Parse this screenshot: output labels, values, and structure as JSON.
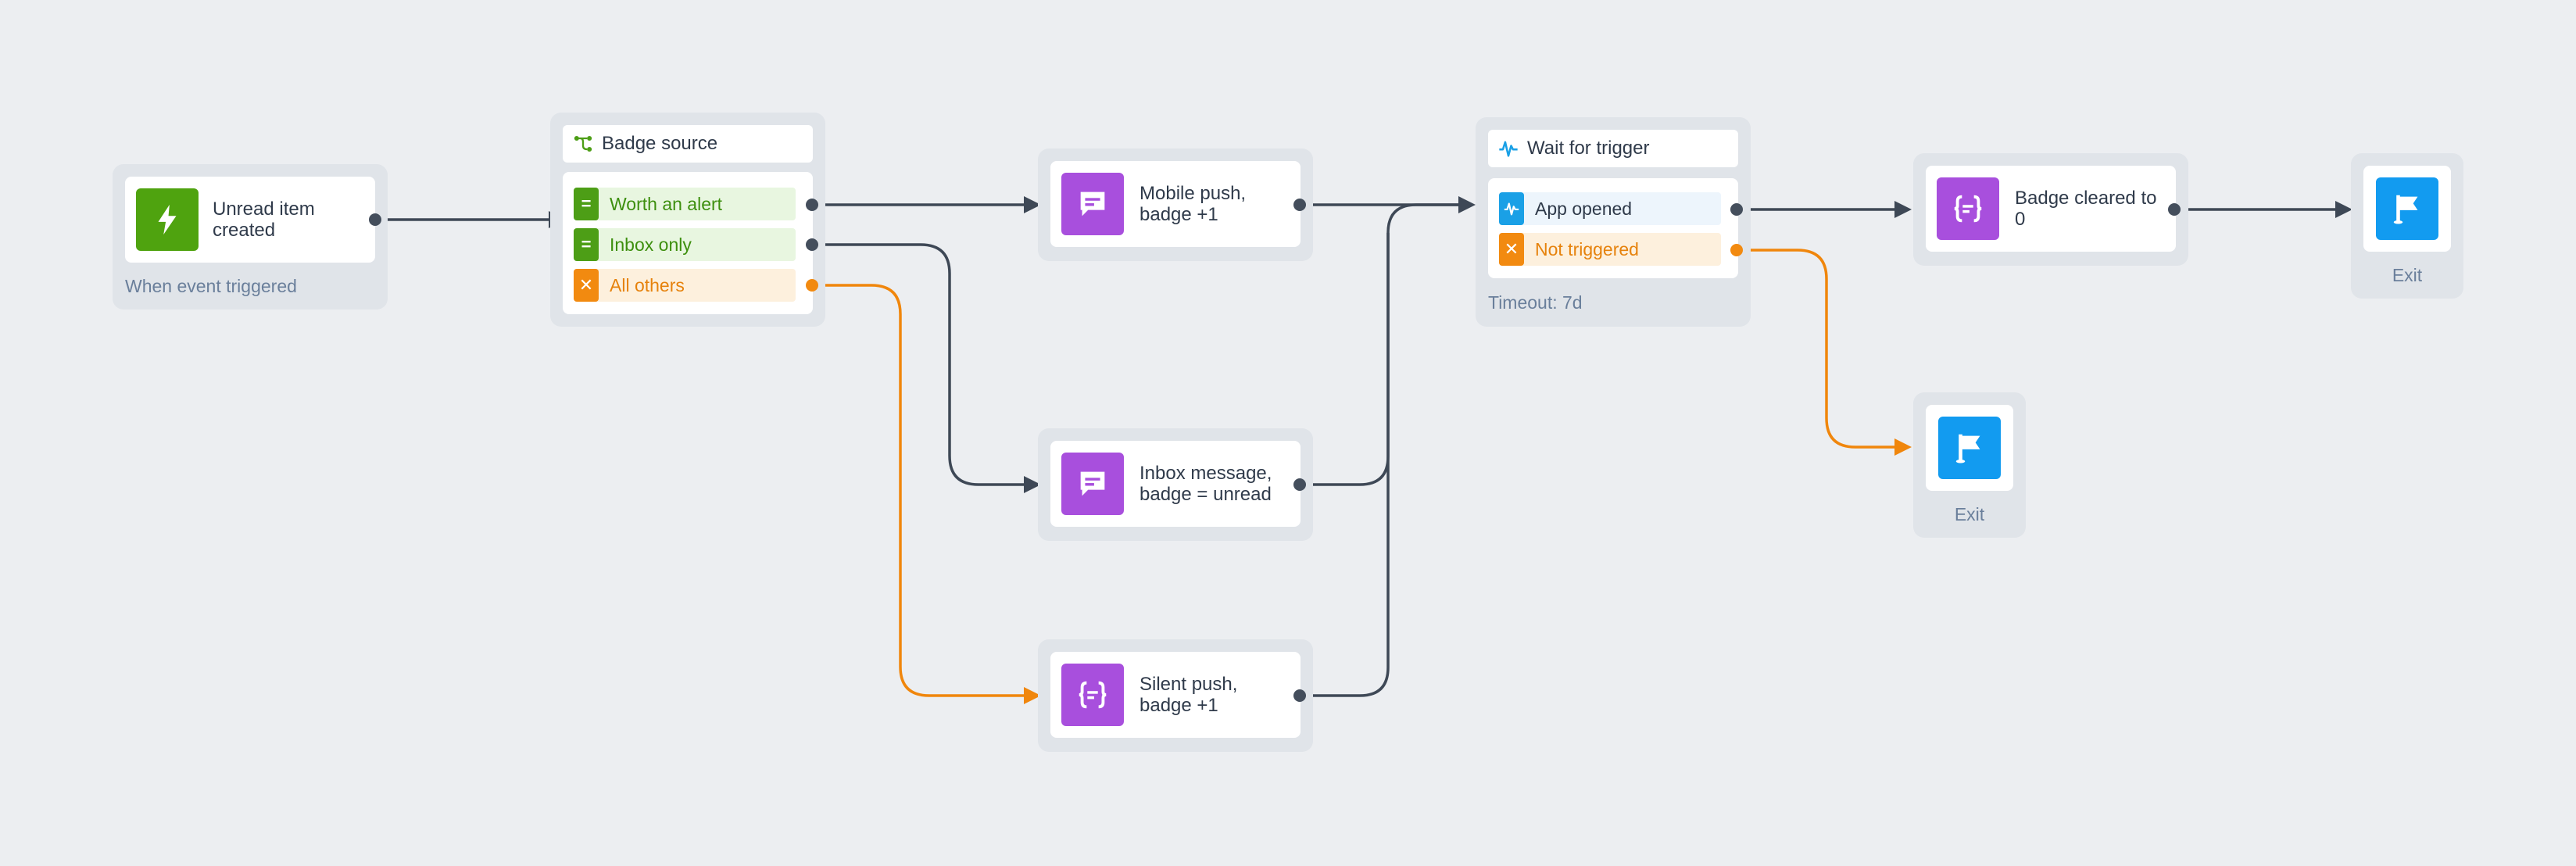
{
  "colors": {
    "background": "#eceef1",
    "wrapper": "#e0e4e9",
    "trigger_green": "#4fa30f",
    "message_purple": "#a84fdd",
    "exit_blue": "#129bf0",
    "branch_green": "#4d9e16",
    "branch_orange": "#f28a10",
    "trigger_blue": "#1aa0e6",
    "connector_dark": "#3e4856",
    "connector_orange": "#f0860c"
  },
  "nodes": {
    "start": {
      "label": "Unread item created",
      "sub": "When event triggered",
      "icon": "lightning-icon"
    },
    "badge_source": {
      "title": "Badge source",
      "icon": "branch-icon",
      "branches": [
        {
          "label": "Worth an alert",
          "icon": "equals-icon"
        },
        {
          "label": "Inbox only",
          "icon": "equals-icon"
        },
        {
          "label": "All others",
          "icon": "x-icon"
        }
      ]
    },
    "mobile_push": {
      "label": "Mobile push, badge +1",
      "icon": "chat-icon"
    },
    "inbox_message": {
      "label": "Inbox message, badge = unread",
      "icon": "chat-icon"
    },
    "silent_push": {
      "label": "Silent push, badge +1",
      "icon": "code-braces-icon"
    },
    "wait": {
      "title": "Wait for trigger",
      "icon": "pulse-icon",
      "branches": [
        {
          "label": "App opened",
          "icon": "pulse-icon"
        },
        {
          "label": "Not triggered",
          "icon": "x-icon"
        }
      ],
      "sub": "Timeout: 7d"
    },
    "badge_cleared": {
      "label": "Badge cleared to 0",
      "icon": "code-braces-icon"
    },
    "exit_main": {
      "label": "Exit",
      "icon": "flag-icon"
    },
    "exit_alt": {
      "label": "Exit",
      "icon": "flag-icon"
    }
  }
}
